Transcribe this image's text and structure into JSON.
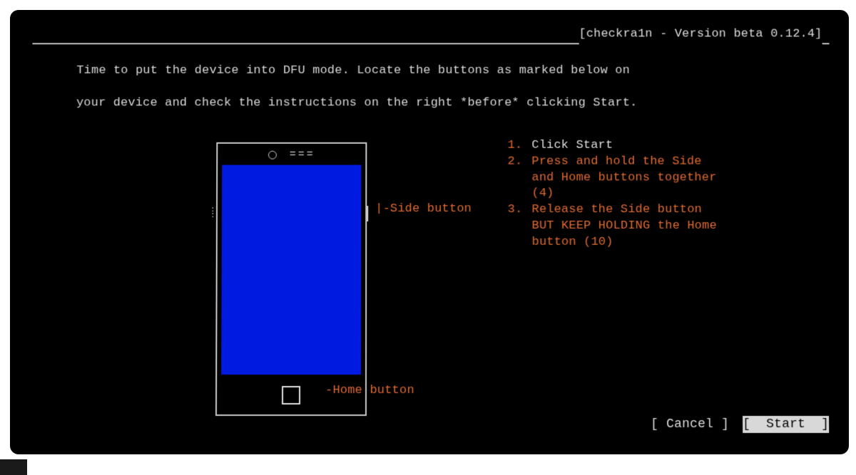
{
  "header": {
    "title": "[checkra1n - Version beta 0.12.4]"
  },
  "instruction": {
    "line1": "Time to put the device into DFU mode. Locate the buttons as marked below on",
    "line2": "your device and check the instructions on the right *before* clicking Start."
  },
  "diagram": {
    "side_label": "|-Side button",
    "home_label": "-Home button",
    "speaker_glyph": "===",
    "vol_dots": ": :"
  },
  "steps": {
    "n1": "1.",
    "t1": "Click Start",
    "n2": "2.",
    "t2a": "Press and hold the Side",
    "t2b": "and Home buttons together",
    "t2c": "(4)",
    "n3": "3.",
    "t3a": "Release the Side button",
    "t3b": "BUT KEEP HOLDING the Home",
    "t3c": "button (10)"
  },
  "buttons": {
    "cancel": "[ Cancel ]",
    "start": "[  Start  ]"
  }
}
